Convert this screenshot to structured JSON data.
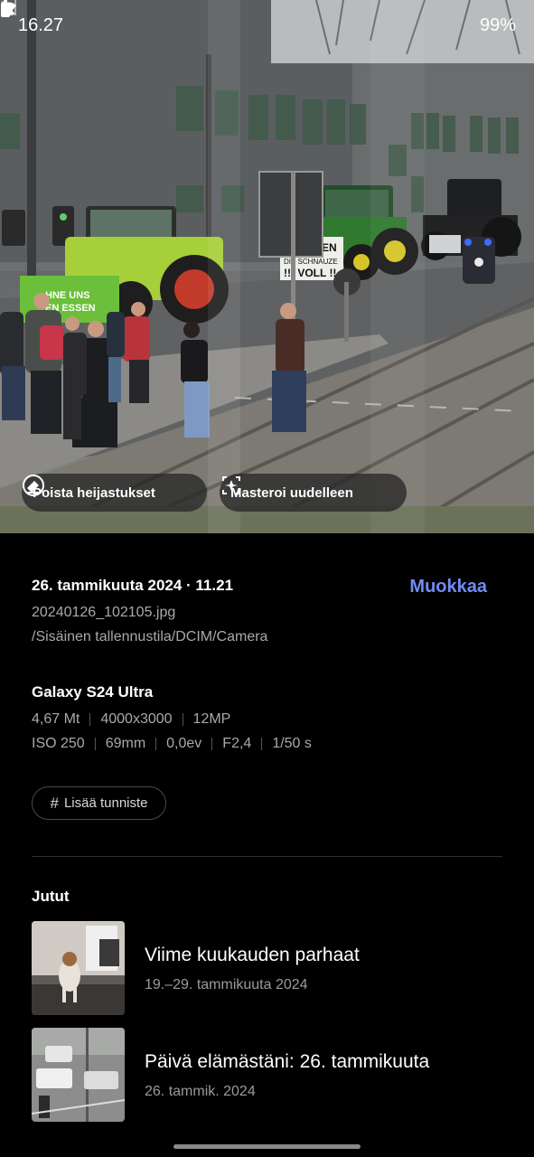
{
  "status_bar": {
    "time": "16.27",
    "battery": "99%",
    "icons": [
      "mute-icon",
      "wifi-icon",
      "signal-icon",
      "battery-icon"
    ]
  },
  "photo": {
    "chips": {
      "remove_reflections": "Poista heijastukset",
      "remaster": "Masteroi uudelleen"
    },
    "signs": {
      "tractor_banner_line1": "HNE UNS",
      "tractor_banner_line2": "EN ESSEN",
      "sign_line1": "EN",
      "sign_line2": "DIE SCHNAUZE",
      "sign_line3": "!!! VOLL !!"
    }
  },
  "details": {
    "date": "26. tammikuuta 2024 · 11.21",
    "edit_label": "Muokkaa",
    "filename": "20240126_102105.jpg",
    "path": "/Sisäinen tallennustila/DCIM/Camera",
    "device": "Galaxy S24 Ultra",
    "specs_row1": [
      "4,67 Mt",
      "4000x3000",
      "12MP"
    ],
    "specs_row2": [
      "ISO 250",
      "69mm",
      "0,0ev",
      "F2,4",
      "1/50 s"
    ],
    "add_tag_label": "Lisää tunniste",
    "accent_color": "#6f8cf4"
  },
  "stories": {
    "title": "Jutut",
    "items": [
      {
        "title": "Viime kuukauden parhaat",
        "date": "19.–29. tammikuuta 2024"
      },
      {
        "title": "Päivä elämästäni: 26. tammikuuta",
        "date": "26. tammik. 2024"
      }
    ]
  }
}
